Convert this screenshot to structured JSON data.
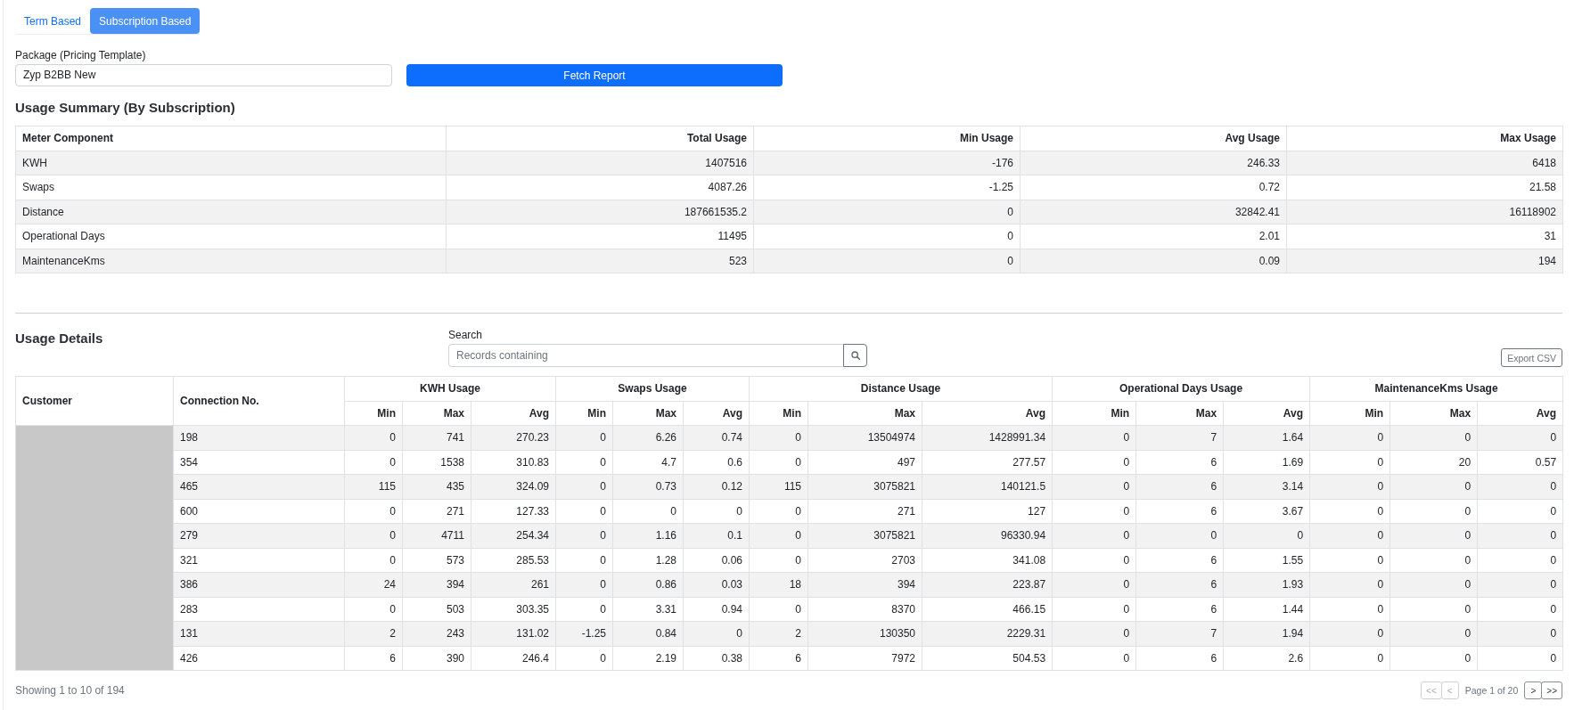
{
  "tabs": [
    {
      "label": "Term Based",
      "selected": false
    },
    {
      "label": "Subscription Based",
      "selected": true
    }
  ],
  "package": {
    "label": "Package (Pricing Template)",
    "value": "Zyp B2BB New"
  },
  "fetch_button": "Fetch Report",
  "summary": {
    "title": "Usage Summary (By Subscription)",
    "columns": [
      "Meter Component",
      "Total Usage",
      "Min Usage",
      "Avg Usage",
      "Max Usage"
    ],
    "rows": [
      [
        "KWH",
        "1407516",
        "-176",
        "246.33",
        "6418"
      ],
      [
        "Swaps",
        "4087.26",
        "-1.25",
        "0.72",
        "21.58"
      ],
      [
        "Distance",
        "187661535.2",
        "0",
        "32842.41",
        "16118902"
      ],
      [
        "Operational Days",
        "11495",
        "0",
        "2.01",
        "31"
      ],
      [
        "MaintenanceKms",
        "523",
        "0",
        "0.09",
        "194"
      ]
    ]
  },
  "details": {
    "title": "Usage Details",
    "search": {
      "label": "Search",
      "placeholder": "Records containing"
    },
    "export_button": "Export CSV",
    "columns": [
      "Customer",
      "Connection No."
    ],
    "groups": [
      {
        "label": "KWH Usage",
        "subcolumns": [
          "Min",
          "Max",
          "Avg"
        ]
      },
      {
        "label": "Swaps Usage",
        "subcolumns": [
          "Min",
          "Max",
          "Avg"
        ]
      },
      {
        "label": "Distance Usage",
        "subcolumns": [
          "Min",
          "Max",
          "Avg"
        ]
      },
      {
        "label": "Operational Days Usage",
        "subcolumns": [
          "Min",
          "Max",
          "Avg"
        ]
      },
      {
        "label": "MaintenanceKms Usage",
        "subcolumns": [
          "Min",
          "Max",
          "Avg"
        ]
      }
    ],
    "rows": [
      {
        "connection": "198",
        "values": [
          "0",
          "741",
          "270.23",
          "0",
          "6.26",
          "0.74",
          "0",
          "13504974",
          "1428991.34",
          "0",
          "7",
          "1.64",
          "0",
          "0",
          "0"
        ]
      },
      {
        "connection": "354",
        "values": [
          "0",
          "1538",
          "310.83",
          "0",
          "4.7",
          "0.6",
          "0",
          "497",
          "277.57",
          "0",
          "6",
          "1.69",
          "0",
          "20",
          "0.57"
        ]
      },
      {
        "connection": "465",
        "values": [
          "115",
          "435",
          "324.09",
          "0",
          "0.73",
          "0.12",
          "115",
          "3075821",
          "140121.5",
          "0",
          "6",
          "3.14",
          "0",
          "0",
          "0"
        ]
      },
      {
        "connection": "600",
        "values": [
          "0",
          "271",
          "127.33",
          "0",
          "0",
          "0",
          "0",
          "271",
          "127",
          "0",
          "6",
          "3.67",
          "0",
          "0",
          "0"
        ]
      },
      {
        "connection": "279",
        "values": [
          "0",
          "4711",
          "254.34",
          "0",
          "1.16",
          "0.1",
          "0",
          "3075821",
          "96330.94",
          "0",
          "0",
          "0",
          "0",
          "0",
          "0"
        ]
      },
      {
        "connection": "321",
        "values": [
          "0",
          "573",
          "285.53",
          "0",
          "1.28",
          "0.06",
          "0",
          "2703",
          "341.08",
          "0",
          "6",
          "1.55",
          "0",
          "0",
          "0"
        ]
      },
      {
        "connection": "386",
        "values": [
          "24",
          "394",
          "261",
          "0",
          "0.86",
          "0.03",
          "18",
          "394",
          "223.87",
          "0",
          "6",
          "1.93",
          "0",
          "0",
          "0"
        ]
      },
      {
        "connection": "283",
        "values": [
          "0",
          "503",
          "303.35",
          "0",
          "3.31",
          "0.94",
          "0",
          "8370",
          "466.15",
          "0",
          "6",
          "1.44",
          "0",
          "0",
          "0"
        ]
      },
      {
        "connection": "131",
        "values": [
          "2",
          "243",
          "131.02",
          "-1.25",
          "0.84",
          "0",
          "2",
          "130350",
          "2229.31",
          "0",
          "7",
          "1.94",
          "0",
          "0",
          "0"
        ]
      },
      {
        "connection": "426",
        "values": [
          "6",
          "390",
          "246.4",
          "0",
          "2.19",
          "0.38",
          "6",
          "7972",
          "504.53",
          "0",
          "6",
          "2.6",
          "0",
          "0",
          "0"
        ]
      }
    ],
    "showing": "Showing 1 to 10 of 194",
    "pagination": [
      {
        "kind": "button",
        "label": "<<",
        "disabled": true
      },
      {
        "kind": "button",
        "label": "<",
        "disabled": true
      },
      {
        "kind": "text",
        "label": "Page 1 of 20"
      },
      {
        "kind": "button",
        "label": ">",
        "disabled": false
      },
      {
        "kind": "button",
        "label": ">>",
        "disabled": false
      }
    ]
  }
}
